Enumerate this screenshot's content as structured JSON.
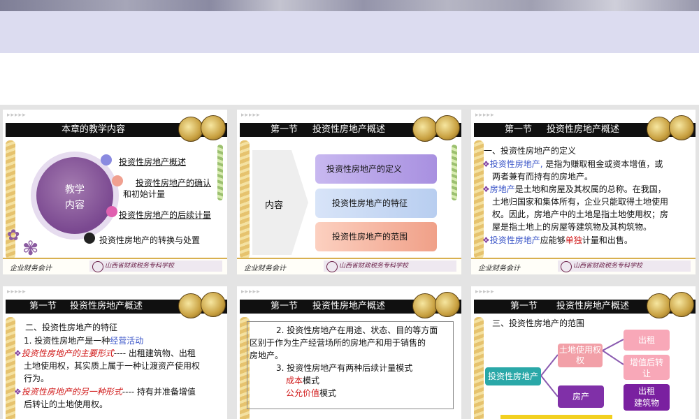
{
  "colors": {
    "banner": "#dcdcf0",
    "titlebar": "#101010",
    "accent_purple": "#7a4890",
    "link_blue": "#3a55c8",
    "highlight_red": "#d01818"
  },
  "footer": {
    "left_label": "企业财务会计",
    "right_label": "山西省财政税务专科学校"
  },
  "slide1": {
    "title": "本章的教学内容",
    "circle_line1": "教学",
    "circle_line2": "内容",
    "items": [
      "投资性房地产概述",
      "投资性房地产的确认",
      "和初始计量",
      "投资性房地产的后续计量",
      "投资性房地产的转换与处置"
    ]
  },
  "slide2": {
    "title_sec": "第一节",
    "title_text": "投资性房地产概述",
    "arrow_label": "内容",
    "pills": [
      "投资性房地产的定义",
      "投资性房地产的特征",
      "投资性房地产的范围"
    ]
  },
  "slide3": {
    "title_sec": "第一节",
    "title_text": "投资性房地产概述",
    "heading": "一、投资性房地产的定义",
    "p1_term": "投资性房地产,",
    "p1_rest": "是指为赚取租金或资本增值，或",
    "p1_line2": "两者兼有而持有的房地产。",
    "p2_term": "房地产",
    "p2_rest": "是土地和房屋及其权属的总称。在我国，",
    "p2_line2": "土地归国家和集体所有，企业只能取得土地使用",
    "p2_line3": "权。因此，房地产中的土地是指土地使用权；房",
    "p2_line4": "屋是指土地上的房屋等建筑物及其构筑物。",
    "p3_term": "投资性房地产",
    "p3_mid": "应能够",
    "p3_red": "单独",
    "p3_rest": "计量和出售。"
  },
  "slide4": {
    "title_sec": "第一节",
    "title_text": "投资性房地产概述",
    "heading": "二、投资性房地产的特征",
    "l1a": "1. 投资性房地产是一种",
    "l1b": "经营活动",
    "l2a": "投资性房地产的主要形式",
    "l2b": "----  出租建筑物、出租",
    "l3": "土地使用权，其实质上属于一种让渡资产使用权",
    "l4": "行为。",
    "l5a": "投资性房地产的另一种形式",
    "l5b": "----  持有并准备增值",
    "l6": "后转让的土地使用权。"
  },
  "slide5": {
    "title_sec": "第一节",
    "title_text": "投资性房地产概述",
    "l1": "2. 投资性房地产在用途、状态、目的等方面",
    "l2": "区别于作为生产经营场所的房地产和用于销售的",
    "l3": "房地产。",
    "l4": "3. 投资性房地产有两种后续计量模式",
    "l5a": "成本",
    "l5b": "模式",
    "l6a": "公允价值",
    "l6b": "模式"
  },
  "slide6": {
    "title_sec": "第一节",
    "title_text": "投资性房地产概述",
    "heading": "三、投资性房地产的范围",
    "root": "投资性房地产",
    "land": "土地使用权",
    "land2": "权",
    "house": "房产",
    "lease": "出租",
    "hold1": "增值后转",
    "hold2": "让",
    "lease_b1": "出租",
    "lease_b2": "建筑物"
  }
}
